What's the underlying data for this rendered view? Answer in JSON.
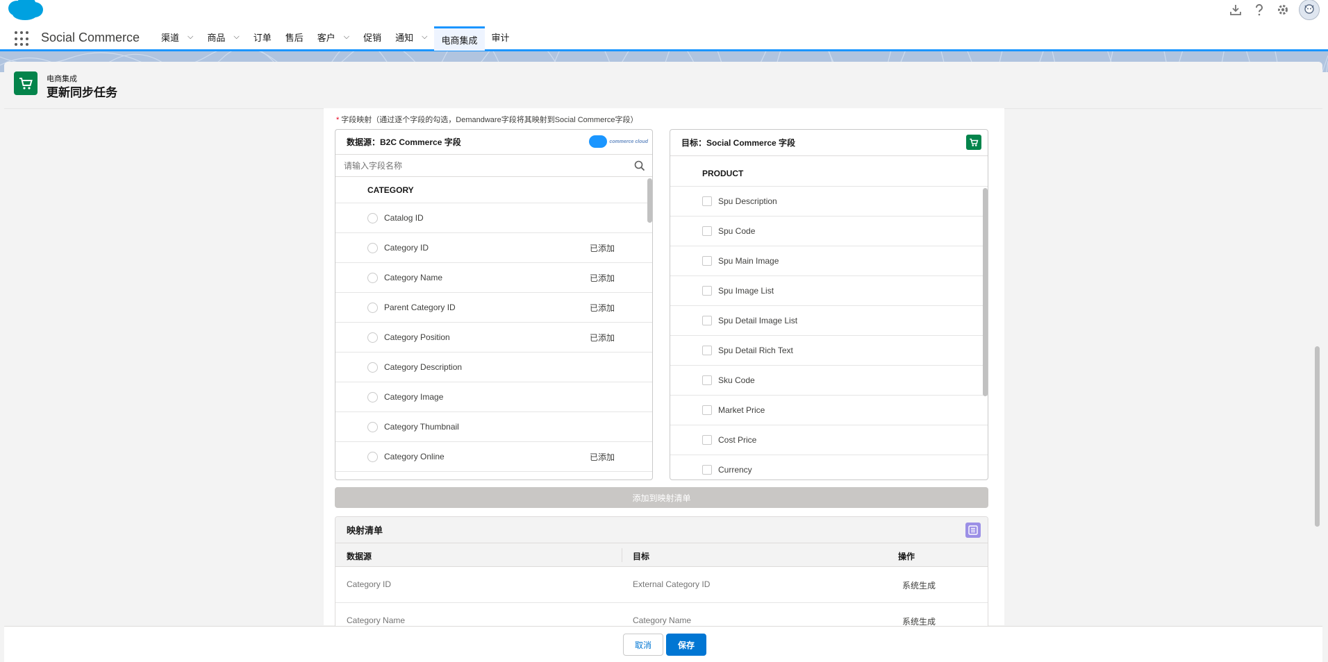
{
  "header": {
    "utility_icons": [
      "download-icon",
      "help-icon",
      "settings-icon"
    ],
    "avatar": "user-avatar"
  },
  "nav": {
    "app_name": "Social Commerce",
    "items": [
      {
        "label": "渠道",
        "dropdown": true
      },
      {
        "label": "商品",
        "dropdown": true
      },
      {
        "label": "订单",
        "dropdown": false
      },
      {
        "label": "售后",
        "dropdown": false
      },
      {
        "label": "客户",
        "dropdown": true
      },
      {
        "label": "促销",
        "dropdown": false
      },
      {
        "label": "通知",
        "dropdown": true
      },
      {
        "label": "电商集成",
        "dropdown": false,
        "active": true
      },
      {
        "label": "审计",
        "dropdown": false
      }
    ]
  },
  "page_header": {
    "subtitle": "电商集成",
    "title": "更新同步任务"
  },
  "field_mapping": {
    "label": "字段映射（通过逐个字段的勾选，Demandware字段将其映射到Social Commerce字段）",
    "source": {
      "title": "数据源：B2C Commerce 字段",
      "logo_text": "commerce cloud",
      "search_placeholder": "请输入字段名称",
      "group": "CATEGORY",
      "items": [
        {
          "label": "Catalog ID",
          "status": ""
        },
        {
          "label": "Category ID",
          "status": "已添加"
        },
        {
          "label": "Category Name",
          "status": "已添加"
        },
        {
          "label": "Parent Category ID",
          "status": "已添加"
        },
        {
          "label": "Category Position",
          "status": "已添加"
        },
        {
          "label": "Category Description",
          "status": ""
        },
        {
          "label": "Category Image",
          "status": ""
        },
        {
          "label": "Category Thumbnail",
          "status": ""
        },
        {
          "label": "Category Online",
          "status": "已添加"
        }
      ]
    },
    "target": {
      "title": "目标：Social Commerce 字段",
      "group": "PRODUCT",
      "items": [
        "Spu Description",
        "Spu Code",
        "Spu Main Image",
        "Spu Image List",
        "Spu Detail Image List",
        "Spu Detail Rich Text",
        "Sku Code",
        "Market Price",
        "Cost Price",
        "Currency"
      ]
    },
    "add_button": "添加到映射清单"
  },
  "mapping_list": {
    "title": "映射清单",
    "columns": [
      "数据源",
      "目标",
      "操作"
    ],
    "rows": [
      {
        "source": "Category ID",
        "target": "External Category ID",
        "op": "系统生成"
      },
      {
        "source": "Category Name",
        "target": "Category Name",
        "op": "系统生成"
      }
    ]
  },
  "footer": {
    "cancel": "取消",
    "save": "保存"
  },
  "colors": {
    "brand_blue": "#0176d3",
    "nav_active": "#1b96ff",
    "commerce_green": "#04844b",
    "disabled_button": "#c9c7c5",
    "list_icon": "#9b8fe6"
  }
}
